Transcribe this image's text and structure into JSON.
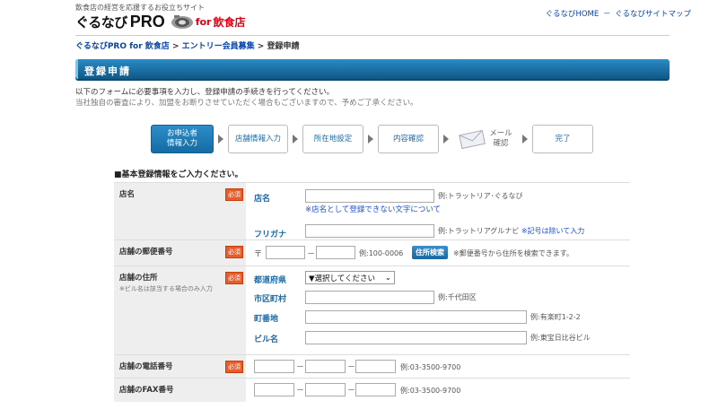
{
  "header": {
    "tagline": "飲食店の経営を応援するお役立ちサイト",
    "logo_main": "ぐるなび",
    "logo_pro": "PRO",
    "logo_for": "for",
    "logo_food": "飲食店",
    "link_home": "ぐるなびHOME",
    "link_sep": "－",
    "link_sitemap": "ぐるなびサイトマップ"
  },
  "breadcrumb": {
    "item1": "ぐるなびPRO for 飲食店",
    "sep": " > ",
    "item2": "エントリー会員募集",
    "item3": "登録申請"
  },
  "page_title": "登録申請",
  "intro": {
    "line1": "以下のフォームに必要事項を入力し、登録申請の手続きを行ってください。",
    "line2": "当社独自の審査により、加盟をお断りさせていただく場合もございますので、予めご了承ください。"
  },
  "steps": [
    {
      "line1": "お申込者",
      "line2": "情報入力"
    },
    {
      "line1": "店舗情報入力",
      "line2": ""
    },
    {
      "line1": "所在地設定",
      "line2": ""
    },
    {
      "line1": "内容確認",
      "line2": ""
    },
    {
      "line1": "メール",
      "line2": "確認"
    },
    {
      "line1": "完了",
      "line2": ""
    }
  ],
  "section_head": "■基本登録情報をご入力ください。",
  "required_label": "必須",
  "form": {
    "shop_name": {
      "label": "店名",
      "field_name": "店名",
      "name_hint": "例:トラットリア･ぐるなび",
      "name_note": "※店名として登録できない文字について",
      "field_kana": "フリガナ",
      "kana_hint": "例:トラットリアグルナビ",
      "kana_note": "※記号は除いて入力"
    },
    "postal": {
      "label": "店舗の郵便番号",
      "mark": "〒",
      "dash": "－",
      "hint": "例:100-0006",
      "button": "住所検索",
      "note": "※郵便番号から住所を検索できます。"
    },
    "address": {
      "label": "店舗の住所",
      "sub": "※ビル名は該当する場合のみ入力",
      "pref_label": "都道府県",
      "pref_select": "▼選択してください",
      "city_label": "市区町村",
      "city_hint": "例:千代田区",
      "street_label": "町番地",
      "street_hint": "例:有楽町1-2-2",
      "building_label": "ビル名",
      "building_hint": "例:東宝日比谷ビル"
    },
    "phone": {
      "label": "店舗の電話番号",
      "dash": "－",
      "hint": "例:03-3500-9700"
    },
    "fax": {
      "label": "店舗のFAX番号",
      "dash": "－",
      "hint": "例:03-3500-9700"
    }
  },
  "colors": {
    "title_bar": "#1a6fa5",
    "required": "#e85b2a",
    "link": "#0645ad",
    "brand_red": "#e60012"
  }
}
